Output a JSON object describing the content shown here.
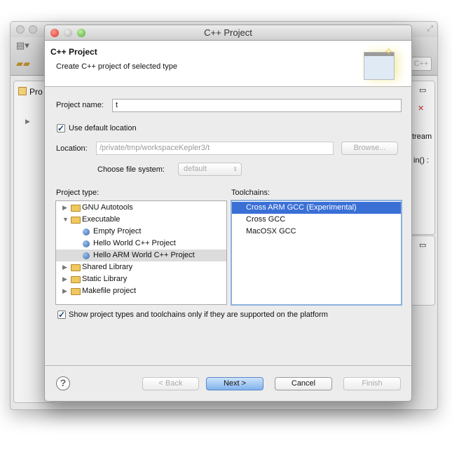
{
  "background_window": {
    "project_explorer_label": "Pro",
    "perspective_label": "C++",
    "code_fragment_1": "tream",
    "code_fragment_2": "in() :"
  },
  "dialog": {
    "window_title": "C++ Project",
    "banner": {
      "title": "C++ Project",
      "subtitle": "Create C++ project of selected type"
    },
    "project_name": {
      "label": "Project name:",
      "value": "t"
    },
    "use_default_location": {
      "label": "Use default location",
      "checked": true
    },
    "location": {
      "label": "Location:",
      "value": "/private/tmp/workspaceKepler3/t",
      "browse_label": "Browse..."
    },
    "file_system": {
      "label": "Choose file system:",
      "value": "default"
    },
    "project_type": {
      "label": "Project type:",
      "items": [
        {
          "label": "GNU Autotools",
          "kind": "folder",
          "expanded": false
        },
        {
          "label": "Executable",
          "kind": "folder",
          "expanded": true
        },
        {
          "label": "Empty Project",
          "kind": "item"
        },
        {
          "label": "Hello World C++ Project",
          "kind": "item"
        },
        {
          "label": "Hello ARM World C++ Project",
          "kind": "item",
          "selected": true
        },
        {
          "label": "Shared Library",
          "kind": "folder",
          "expanded": false
        },
        {
          "label": "Static Library",
          "kind": "folder",
          "expanded": false
        },
        {
          "label": "Makefile project",
          "kind": "folder",
          "expanded": false
        }
      ]
    },
    "toolchains": {
      "label": "Toolchains:",
      "items": [
        {
          "label": "Cross ARM GCC (Experimental)",
          "selected": true
        },
        {
          "label": "Cross GCC"
        },
        {
          "label": "MacOSX GCC"
        }
      ]
    },
    "show_supported": {
      "label": "Show project types and toolchains only if they are supported on the platform",
      "checked": true
    },
    "buttons": {
      "help": "?",
      "back": "< Back",
      "next": "Next >",
      "cancel": "Cancel",
      "finish": "Finish"
    },
    "colors": {
      "selection": "#3a6fd6",
      "accent": "#7fb2ec"
    }
  }
}
